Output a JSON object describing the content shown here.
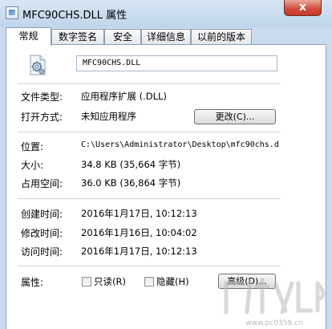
{
  "window": {
    "title": "MFC90CHS.DLL 属性",
    "close_glyph": "x"
  },
  "tabs": [
    {
      "label": "常规",
      "active": true
    },
    {
      "label": "数字签名",
      "active": false
    },
    {
      "label": "安全",
      "active": false
    },
    {
      "label": "详细信息",
      "active": false
    },
    {
      "label": "以前的版本",
      "active": false
    }
  ],
  "general": {
    "icon": "dll-settings-file-icon",
    "file_name": "MFC90CHS.DLL",
    "file_type_label": "文件类型:",
    "file_type_value": "应用程序扩展 (.DLL)",
    "opens_with_label": "打开方式:",
    "opens_with_value": "未知应用程序",
    "change_button": "更改(C)...",
    "location_label": "位置:",
    "location_value": "C:\\Users\\Administrator\\Desktop\\mfc90chs.d",
    "size_label": "大小:",
    "size_value": "34.8 KB (35,664 字节)",
    "size_on_disk_label": "占用空间:",
    "size_on_disk_value": "36.0 KB (36,864 字节)",
    "created_label": "创建时间:",
    "created_value": "2016年1月17日, 10:12:13",
    "modified_label": "修改时间:",
    "modified_value": "2016年1月16日, 10:04:02",
    "accessed_label": "访问时间:",
    "accessed_value": "2016年1月17日, 10:12:13",
    "attributes_label": "属性:",
    "readonly_label": "只读(R)",
    "readonly_checked": false,
    "hidden_label": "隐藏(H)",
    "hidden_checked": false,
    "advanced_button": "高级(D)..."
  },
  "watermark": {
    "site": "www.pc0359.cn"
  }
}
